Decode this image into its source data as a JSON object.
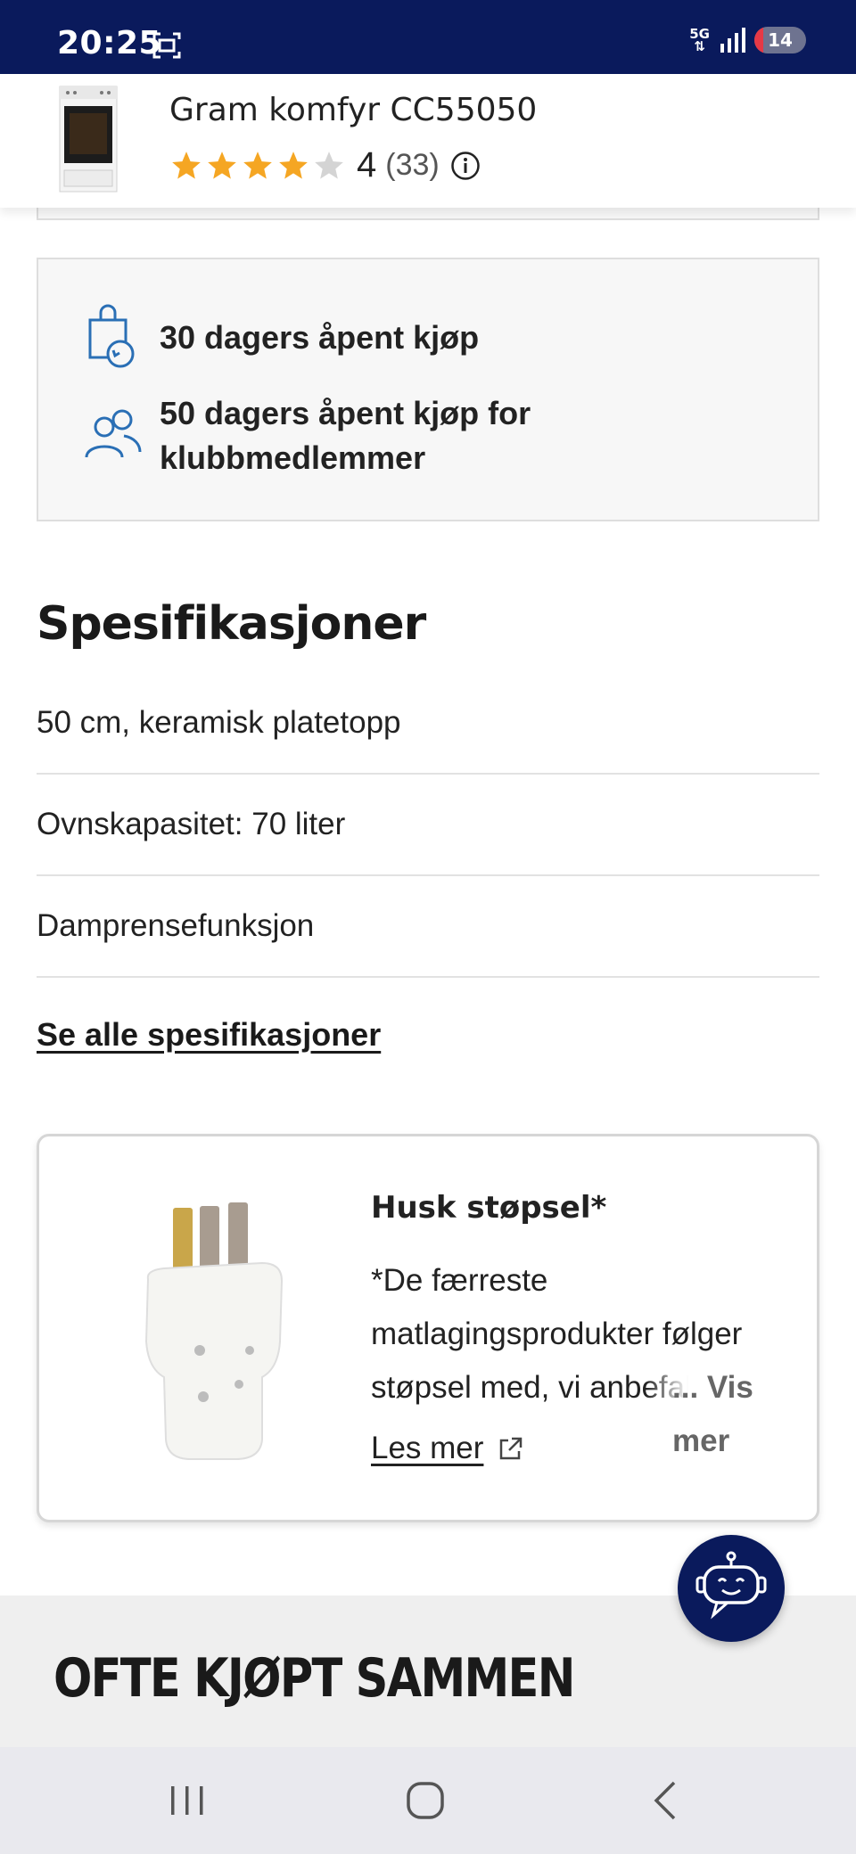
{
  "status_bar": {
    "time": "20:25",
    "network": "5G",
    "battery": "14"
  },
  "product": {
    "name": "Gram komfyr CC55050",
    "rating": "4",
    "rating_count": "(33)",
    "stars_filled": 4,
    "stars_total": 5
  },
  "open_purchase": {
    "items": [
      {
        "icon": "shopping-bag-return-icon",
        "text": "30 dagers åpent kjøp"
      },
      {
        "icon": "people-icon",
        "text": "50 dagers åpent kjøp for klubbmedlemmer"
      }
    ]
  },
  "specs": {
    "title": "Spesifikasjoner",
    "items": [
      "50 cm, keramisk platetopp",
      "Ovnskapasitet: 70 liter",
      "Damprensefunksjon"
    ],
    "see_all_label": "Se alle spesifikasjoner"
  },
  "plug_card": {
    "title": "Husk støpsel*",
    "description": "*De færreste matlagingsprodukter følger støpsel med, vi anbefaler",
    "vis_mer": "... Vis mer",
    "les_mer": "Les mer"
  },
  "often_bought": {
    "title": "OFTE KJØPT SAMMEN"
  },
  "colors": {
    "brand_navy": "#0a1a5c",
    "star_gold": "#f5a623",
    "icon_blue": "#2a6fb5"
  }
}
